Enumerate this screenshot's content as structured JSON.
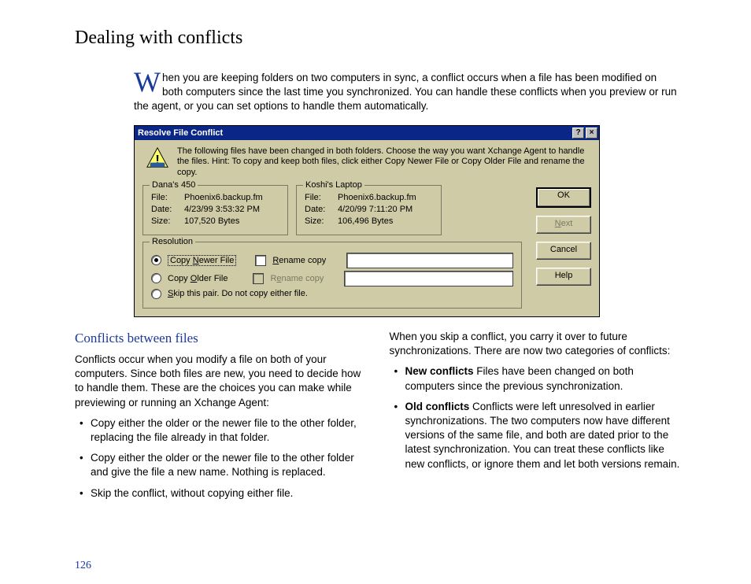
{
  "page": {
    "title": "Dealing with conflicts",
    "intro_dropcap": "W",
    "intro_text": "hen you are keeping folders on two computers in sync, a conflict occurs when a file has been modified on both computers since the last time you synchronized. You can handle these conflicts when you preview or run the agent, or you can set options to handle them automatically.",
    "page_number": "126"
  },
  "dialog": {
    "title": "Resolve File Conflict",
    "instruction": "The following files have been changed in both folders.  Choose the way you want Xchange Agent to handle the files.  Hint: To copy and keep both files, click either Copy Newer File or Copy Older File and rename the copy.",
    "left_group": {
      "legend": "Dana's 450",
      "file_label": "File:",
      "file_value": "Phoenix6.backup.fm",
      "date_label": "Date:",
      "date_value": "4/23/99 3:53:32 PM",
      "size_label": "Size:",
      "size_value": "107,520 Bytes"
    },
    "right_group": {
      "legend": "Koshi's Laptop",
      "file_label": "File:",
      "file_value": "Phoenix6.backup.fm",
      "date_label": "Date:",
      "date_value": "4/20/99 7:11:20 PM",
      "size_label": "Size:",
      "size_value": "106,496 Bytes"
    },
    "resolution": {
      "legend": "Resolution",
      "opt_newer": "Copy Newer File",
      "cb_rename1": "Rename copy",
      "opt_older": "Copy Older File",
      "cb_rename2": "Rename copy",
      "opt_skip": "Skip this pair. Do not copy either file."
    },
    "buttons": {
      "ok": "OK",
      "next": "Next",
      "cancel": "Cancel",
      "help": "Help"
    }
  },
  "body": {
    "subhead": "Conflicts between files",
    "left_para": "Conflicts occur when you modify a file on both of your computers. Since both files are new, you need to decide how to handle them. These are the choices you can make while previewing or running an Xchange Agent:",
    "bullet1": "Copy either the older or the newer file to the other folder, replacing the file already in that folder.",
    "bullet2": "Copy either the older or the newer file to the other folder and give the file a new name. Nothing is replaced.",
    "bullet3": "Skip the conflict, without copying either file.",
    "right_intro": "When you skip a conflict, you carry it over to future synchronizations. There are now two categories of conflicts:",
    "new_bold": "New conflicts",
    "new_text": "   Files have been changed on both computers since the previous synchronization.",
    "old_bold": "Old conflicts",
    "old_text": "   Conflicts were left unresolved in earlier synchronizations. The two computers now have different versions of the same file, and both are dated prior to the latest synchronization. You can treat these conflicts like new conflicts, or ignore them and let both versions remain."
  }
}
